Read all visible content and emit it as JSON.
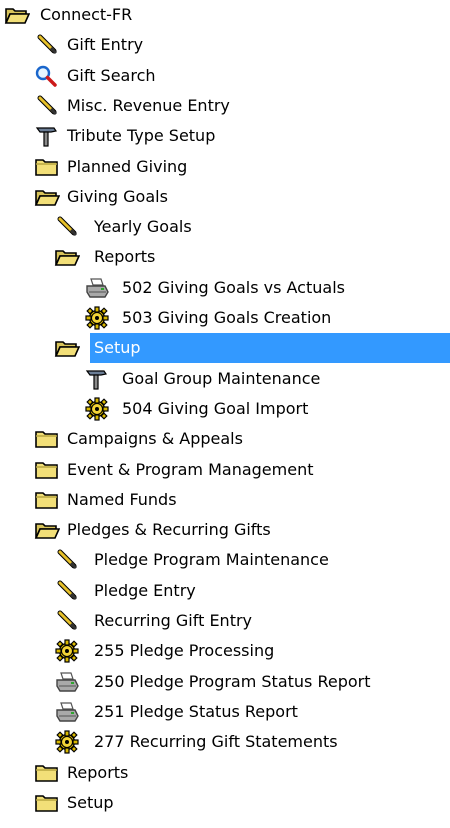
{
  "tree": {
    "items": [
      {
        "label": "Connect-FR",
        "icon": "folder-open-icon",
        "level": 0,
        "selected": false
      },
      {
        "label": "Gift Entry",
        "icon": "pencil-icon",
        "level": 1,
        "selected": false
      },
      {
        "label": "Gift Search",
        "icon": "magnifier-icon",
        "level": 1,
        "selected": false
      },
      {
        "label": "Misc. Revenue Entry",
        "icon": "pencil-icon",
        "level": 1,
        "selected": false
      },
      {
        "label": "Tribute Type Setup",
        "icon": "hammer-icon",
        "level": 1,
        "selected": false
      },
      {
        "label": "Planned Giving",
        "icon": "folder-closed-icon",
        "level": 1,
        "selected": false
      },
      {
        "label": "Giving Goals",
        "icon": "folder-open-icon",
        "level": 1,
        "selected": false
      },
      {
        "label": "Yearly Goals",
        "icon": "pencil-icon",
        "level": 2,
        "selected": false
      },
      {
        "label": "Reports",
        "icon": "folder-open-icon",
        "level": 2,
        "selected": false
      },
      {
        "label": "502 Giving Goals vs Actuals",
        "icon": "printer-icon",
        "level": 3,
        "selected": false
      },
      {
        "label": "503 Giving Goals Creation",
        "icon": "gear-icon",
        "level": 3,
        "selected": false
      },
      {
        "label": "Setup",
        "icon": "folder-open-icon",
        "level": 2,
        "selected": true
      },
      {
        "label": "Goal Group Maintenance",
        "icon": "hammer-icon",
        "level": 3,
        "selected": false
      },
      {
        "label": "504 Giving Goal Import",
        "icon": "gear-icon",
        "level": 3,
        "selected": false
      },
      {
        "label": "Campaigns & Appeals",
        "icon": "folder-closed-icon",
        "level": 1,
        "selected": false
      },
      {
        "label": "Event & Program Management",
        "icon": "folder-closed-icon",
        "level": 1,
        "selected": false
      },
      {
        "label": "Named Funds",
        "icon": "folder-closed-icon",
        "level": 1,
        "selected": false
      },
      {
        "label": "Pledges & Recurring Gifts",
        "icon": "folder-open-icon",
        "level": 1,
        "selected": false
      },
      {
        "label": "Pledge Program Maintenance",
        "icon": "pencil-icon",
        "level": 2,
        "selected": false
      },
      {
        "label": "Pledge Entry",
        "icon": "pencil-icon",
        "level": 2,
        "selected": false
      },
      {
        "label": "Recurring Gift Entry",
        "icon": "pencil-icon",
        "level": 2,
        "selected": false
      },
      {
        "label": "255 Pledge Processing",
        "icon": "gear-icon",
        "level": 2,
        "selected": false
      },
      {
        "label": "250 Pledge Program Status Report",
        "icon": "printer-icon",
        "level": 2,
        "selected": false
      },
      {
        "label": "251 Pledge Status Report",
        "icon": "printer-icon",
        "level": 2,
        "selected": false
      },
      {
        "label": "277 Recurring Gift Statements",
        "icon": "gear-icon",
        "level": 2,
        "selected": false
      },
      {
        "label": "Reports",
        "icon": "folder-closed-icon",
        "level": 1,
        "selected": false
      },
      {
        "label": "Setup",
        "icon": "folder-closed-icon",
        "level": 1,
        "selected": false
      }
    ]
  },
  "colors": {
    "selection_background": "#3399ff",
    "selection_text": "#ffffff",
    "folder_fill": "#f2df78",
    "folder_outline": "#000000"
  }
}
